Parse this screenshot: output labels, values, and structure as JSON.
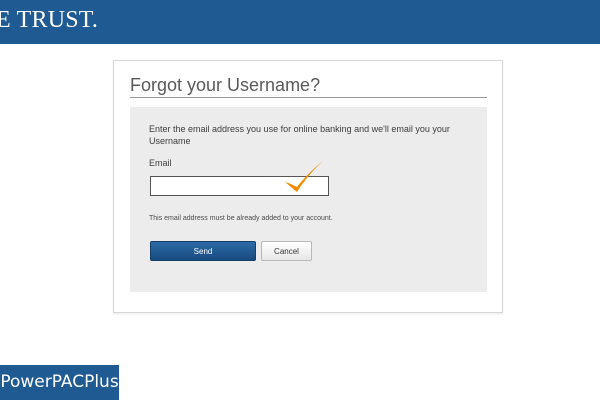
{
  "header": {
    "brand_text": "E TRUST.",
    "background_color": "#1f5a93"
  },
  "form": {
    "title": "Forgot your Username?",
    "instructions": "Enter the email address you use for online banking and we'll email you your Username",
    "email_label": "Email",
    "email_value": "",
    "email_placeholder": "",
    "help_text": "This email address must be already added to your account.",
    "send_label": "Send",
    "cancel_label": "Cancel",
    "checkmark_icon": "checkmark-icon",
    "checkmark_color": "#f28a00"
  },
  "footer": {
    "product_label": "PowerPACPlus"
  }
}
